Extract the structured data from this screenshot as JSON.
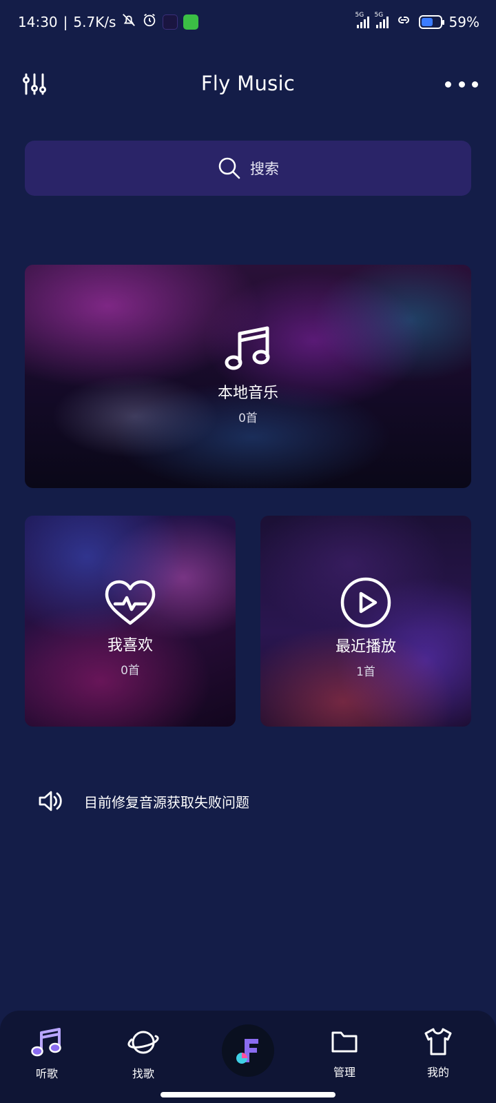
{
  "status_bar": {
    "time": "14:30",
    "speed": "5.7K/s",
    "signal_label_1": "5G",
    "signal_label_2": "5G",
    "battery": "59%"
  },
  "header": {
    "title": "Fly Music"
  },
  "search": {
    "label": "搜索"
  },
  "cards": {
    "local": {
      "name": "本地音乐",
      "count": "0首"
    },
    "favorites": {
      "name": "我喜欢",
      "count": "0首"
    },
    "recent": {
      "name": "最近播放",
      "count": "1首"
    }
  },
  "notice": {
    "text": "目前修复音源获取失败问题"
  },
  "bottom_nav": {
    "items": [
      {
        "label": "听歌",
        "icon": "music-note-icon"
      },
      {
        "label": "找歌",
        "icon": "planet-icon"
      },
      {
        "label": "",
        "icon": "app-logo-icon"
      },
      {
        "label": "管理",
        "icon": "folder-icon"
      },
      {
        "label": "我的",
        "icon": "shirt-icon"
      }
    ]
  },
  "colors": {
    "background": "#141d48",
    "search_bg": "#2a2468",
    "nav_bg": "#0f1535",
    "active_accent": "#8a6cf0"
  }
}
